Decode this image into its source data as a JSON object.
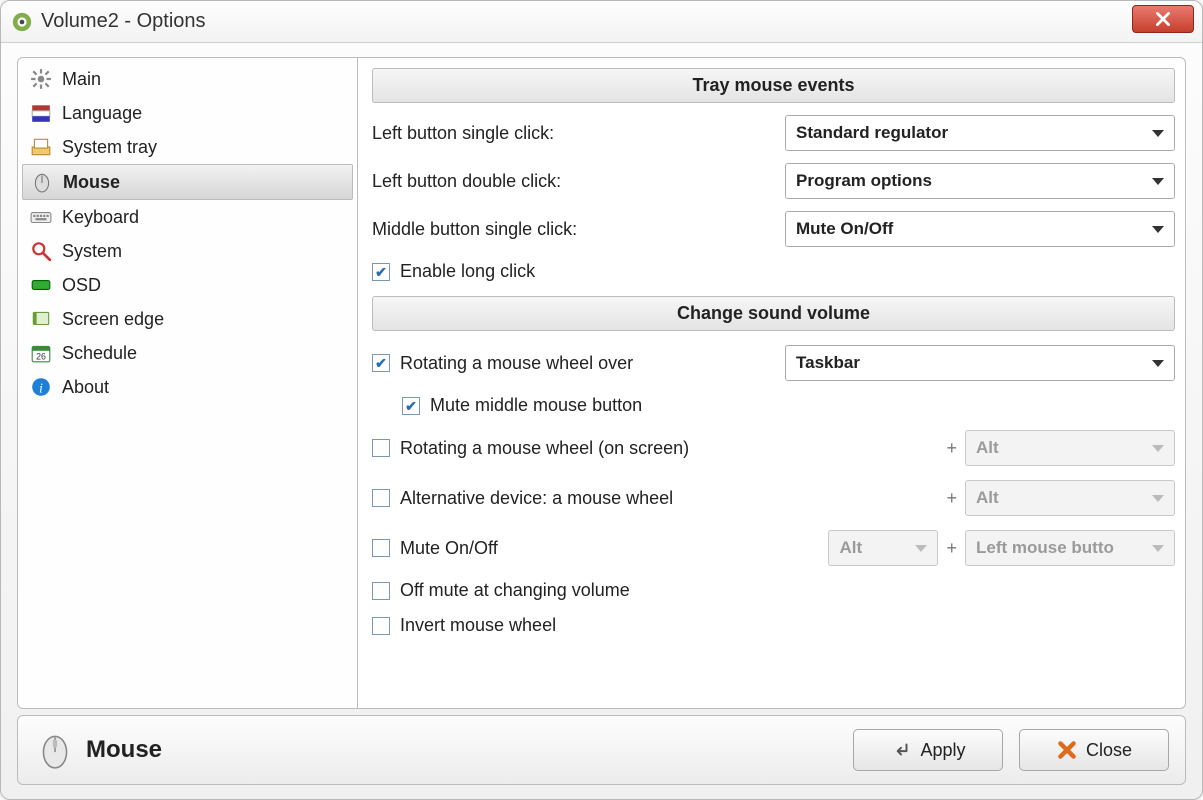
{
  "window": {
    "title": "Volume2 - Options"
  },
  "sidebar": {
    "selected_index": 3,
    "items": [
      {
        "label": "Main",
        "icon": "gear-icon"
      },
      {
        "label": "Language",
        "icon": "flag-icon"
      },
      {
        "label": "System tray",
        "icon": "tray-icon"
      },
      {
        "label": "Mouse",
        "icon": "mouse-icon"
      },
      {
        "label": "Keyboard",
        "icon": "keyboard-icon"
      },
      {
        "label": "System",
        "icon": "magnifier-icon"
      },
      {
        "label": "OSD",
        "icon": "osd-icon"
      },
      {
        "label": "Screen edge",
        "icon": "edge-icon"
      },
      {
        "label": "Schedule",
        "icon": "calendar-icon"
      },
      {
        "label": "About",
        "icon": "info-icon"
      }
    ]
  },
  "sections": {
    "tray_header": "Tray mouse events",
    "change_header": "Change sound volume"
  },
  "tray": {
    "left_single_label": "Left button single click:",
    "left_single_value": "Standard regulator",
    "left_double_label": "Left button double click:",
    "left_double_value": "Program options",
    "middle_single_label": "Middle button single click:",
    "middle_single_value": "Mute On/Off",
    "enable_long_click": {
      "label": "Enable long click",
      "checked": true
    }
  },
  "volume": {
    "rotate_over": {
      "label": "Rotating a mouse wheel over",
      "checked": true,
      "value": "Taskbar"
    },
    "mute_middle": {
      "label": "Mute middle mouse button",
      "checked": true
    },
    "rotate_screen": {
      "label": "Rotating a mouse wheel (on screen)",
      "checked": false,
      "modifier": "Alt"
    },
    "alt_device": {
      "label": "Alternative device: a mouse wheel",
      "checked": false,
      "modifier": "Alt"
    },
    "mute_onoff": {
      "label": "Mute On/Off",
      "checked": false,
      "modifier": "Alt",
      "button": "Left mouse butto"
    },
    "off_mute_change": {
      "label": "Off mute at changing volume",
      "checked": false
    },
    "invert_wheel": {
      "label": "Invert mouse wheel",
      "checked": false
    }
  },
  "footer": {
    "title": "Mouse",
    "apply": "Apply",
    "close": "Close"
  },
  "glyphs": {
    "plus": "+"
  }
}
